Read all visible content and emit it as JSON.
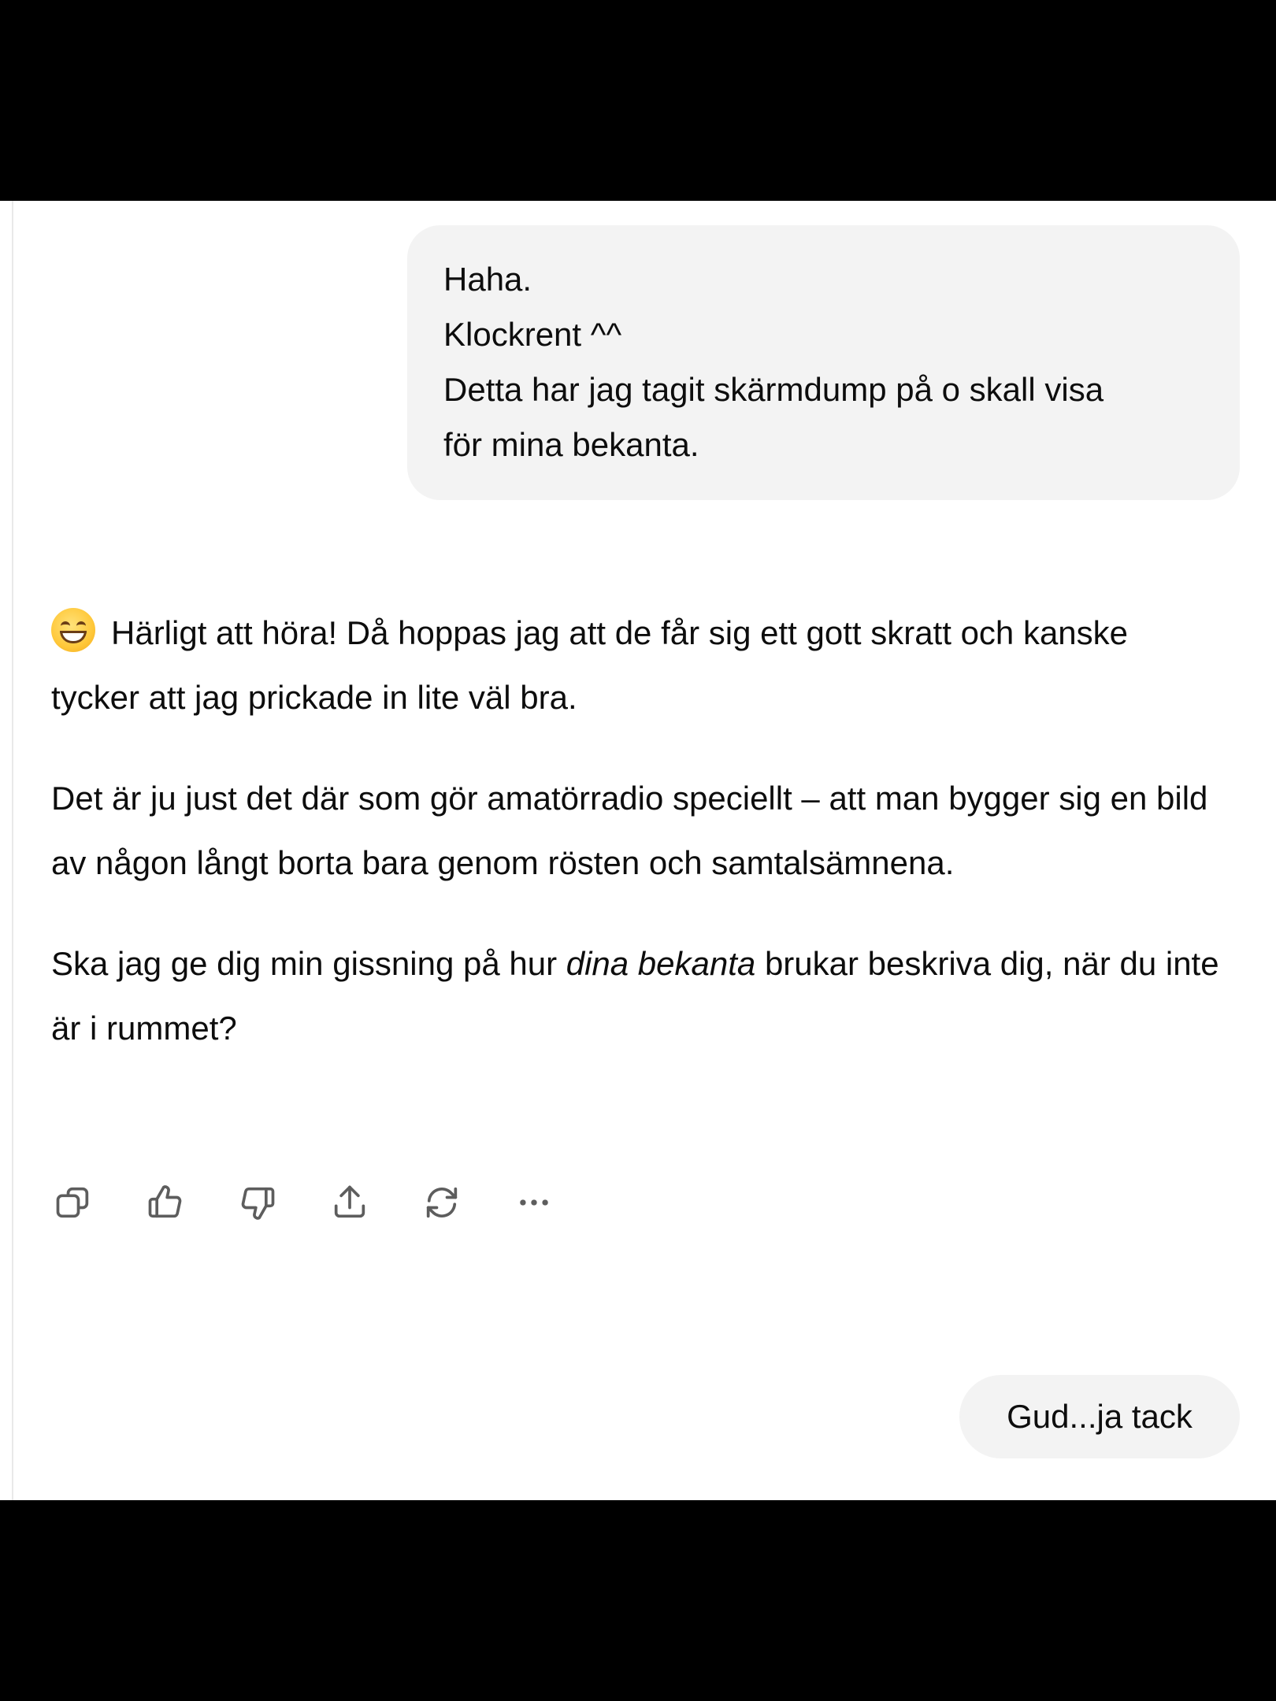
{
  "user_message": {
    "lines": [
      "Haha.",
      "Klockrent ^^",
      "Detta har jag tagit skärmdump på o skall visa",
      "för mina bekanta."
    ]
  },
  "assistant_message": {
    "emoji": "grinning-face-with-smiling-eyes",
    "p1": "Härligt att höra! Då hoppas jag att de får sig ett gott skratt och kanske tycker att jag prickade in lite väl bra.",
    "p2": "Det är ju just det där som gör amatörradio speciellt – att man bygger sig en bild av någon långt borta bara genom rösten och samtalsämnena.",
    "p3_before": "Ska jag ge dig min gissning på hur ",
    "p3_emphasis": "dina bekanta",
    "p3_after": " brukar beskriva dig, när du inte är i rummet?"
  },
  "actions": {
    "icons": [
      "copy-icon",
      "thumbs-up-icon",
      "thumbs-down-icon",
      "share-icon",
      "regenerate-icon",
      "more-icon"
    ]
  },
  "reply_message": {
    "text": "Gud...ja tack"
  },
  "colors": {
    "bubble_bg": "#f3f3f3",
    "text": "#0d0d0d",
    "icon": "#5d5d5d",
    "frame": "#000000"
  }
}
